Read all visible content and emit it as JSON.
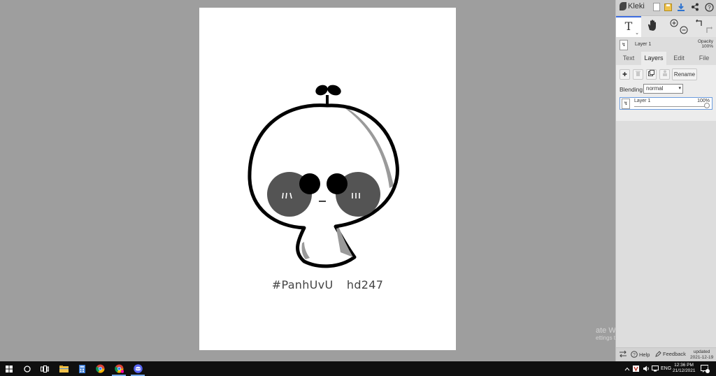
{
  "canvas": {
    "caption_left": "#PanhUvU",
    "caption_right": "hd247"
  },
  "app": {
    "name": "Kleki",
    "tool_text_label": "T",
    "layer_name": "Layer 1",
    "opacity_label": "Opacity",
    "opacity_value": "100%"
  },
  "tabs": [
    {
      "label": "Text"
    },
    {
      "label": "Layers"
    },
    {
      "label": "Edit"
    },
    {
      "label": "File"
    }
  ],
  "layers_panel": {
    "add_label": "✚",
    "rename_label": "Rename",
    "blending_label": "Blending",
    "blending_value": "normal",
    "layer": {
      "name": "Layer 1",
      "opacity": "100%"
    }
  },
  "bottom_bar": {
    "help_label": "Help",
    "feedback_label": "Feedback",
    "updated_label": "updated",
    "updated_date": "2021-12-19"
  },
  "watermark": {
    "line1": "ate Windows",
    "line2": "ettings to activate Windows."
  },
  "taskbar": {
    "language": "ENG",
    "time": "12:36 PM",
    "date": "21/12/2021",
    "notification_count": "2"
  },
  "colors": {
    "accent": "#3d6de0",
    "panel_bg": "#dddddd",
    "workspace_bg": "#9e9e9e",
    "taskbar_bg": "#0f0f0f",
    "discord": "#5865f2"
  }
}
